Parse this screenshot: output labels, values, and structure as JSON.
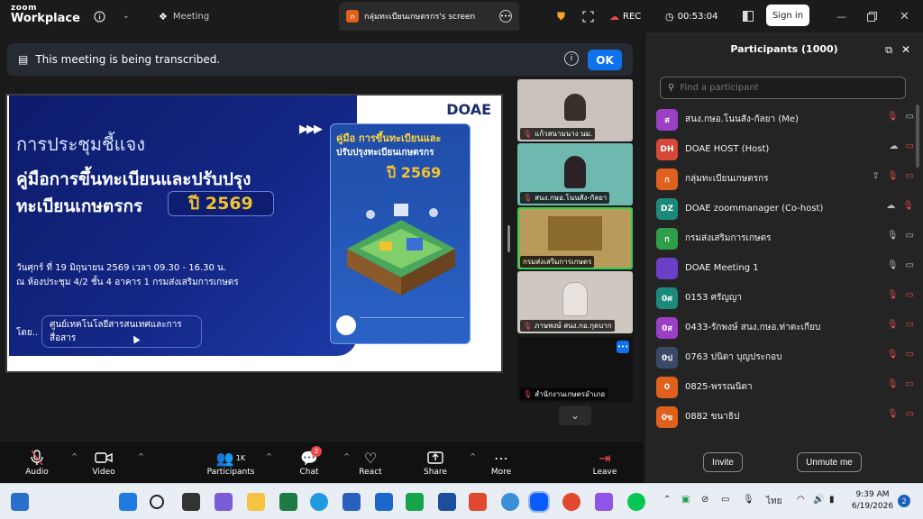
{
  "topbar": {
    "logo_line1": "zoom",
    "logo_line2": "Workplace",
    "meeting_label": "Meeting",
    "share_badge": "ก",
    "share_tab": "กลุ่มทะเบียนเกษตรกร's screen",
    "rec_label": "REC",
    "timer": "00:53:04",
    "signin_label": "Sign in"
  },
  "banner": {
    "text": "This meeting is being transcribed.",
    "ok_label": "OK"
  },
  "slide": {
    "logo": "DOAE",
    "title": "การประชุมชี้แจง",
    "heading1": "คู่มือการขึ้นทะเบียนและปรับปรุง",
    "heading2": "ทะเบียนเกษตรกร",
    "year": "ปี 2569",
    "detail1": "วันศุกร์ ที่ 19 มิถุนายน 2569 เวลา 09.30 - 16.30 น.",
    "detail2": "ณ ห้องประชุม 4/2 ชั้น 4 อาคาร 1 กรมส่งเสริมการเกษตร",
    "by_label": "โดย..",
    "organizer": "ศูนย์เทคโนโลยีสารสนเทศและการสื่อสาร",
    "book_title1": "คู่มือ การขึ้นทะเบียนและ",
    "book_title2": "ปรับปรุงทะเบียนเกษตรกร",
    "book_year": "ปี 2569"
  },
  "thumbnails": [
    {
      "name": "แก้วสนามนาง นม.",
      "bg": "#c9c2bd"
    },
    {
      "name": "สนง.กษอ.โนนสัง-กัลยา",
      "bg": "#6fb8b0"
    },
    {
      "name": "กรมส่งเสริมการเกษตร",
      "bg": "#b89a5a"
    },
    {
      "name": "ภาษพงษ์ สนง.กอ.กุดบาก",
      "bg": "#cfc8c0"
    },
    {
      "name": "สำนักงานเกษตรอำเภอ",
      "bg": "#111111"
    }
  ],
  "toolbar": {
    "audio": "Audio",
    "video": "Video",
    "participants": "Participants",
    "participants_count": "1K",
    "chat": "Chat",
    "chat_badge": "2",
    "react": "React",
    "share": "Share",
    "more": "More",
    "leave": "Leave"
  },
  "panel": {
    "title": "Participants (1000)",
    "search_placeholder": "Find a participant",
    "invite_label": "Invite",
    "unmute_label": "Unmute me",
    "participants": [
      {
        "initials": "ส",
        "color": "#9b3fc7",
        "name": "สนง.กษอ.โนนสัง-กัลยา (Me)",
        "icons": [
          "mic-off",
          "video"
        ]
      },
      {
        "initials": "DH",
        "color": "#d6483a",
        "name": "DOAE HOST (Host)",
        "icons": [
          "cloud",
          "video-off"
        ]
      },
      {
        "initials": "ก",
        "color": "#e0601e",
        "name": "กลุ่มทะเบียนเกษตรกร",
        "icons": [
          "share",
          "mic-off",
          "video-off"
        ]
      },
      {
        "initials": "DZ",
        "color": "#1c8a7a",
        "name": "DOAE zoommanager (Co-host)",
        "icons": [
          "cloud",
          "mic-off"
        ]
      },
      {
        "initials": "ก",
        "color": "#2e9e4a",
        "name": "กรมส่งเสริมการเกษตร",
        "icons": [
          "mic",
          "video"
        ]
      },
      {
        "initials": "",
        "color": "#6c3fc7",
        "name": "DOAE Meeting 1",
        "icons": [
          "mic",
          "video"
        ]
      },
      {
        "initials": "0ศ",
        "color": "#1c8a7a",
        "name": "0153 ศรัญญา",
        "icons": [
          "mic-off",
          "video-off"
        ]
      },
      {
        "initials": "0ส",
        "color": "#9b3fc7",
        "name": "0433-รักพงษ์ สนง.กษอ.ท่าตะเกียบ",
        "icons": [
          "mic-off",
          "video-off"
        ]
      },
      {
        "initials": "0ป",
        "color": "#3b4a66",
        "name": "0763 ปนิตา บุญประกอบ",
        "icons": [
          "mic-off",
          "video-off"
        ]
      },
      {
        "initials": "0",
        "color": "#e0601e",
        "name": "0825-พรรณนิดา",
        "icons": [
          "mic-off",
          "video-off"
        ]
      },
      {
        "initials": "0ข",
        "color": "#e0601e",
        "name": "0882 ขนาธิป",
        "icons": [
          "mic-off",
          "video-off"
        ]
      }
    ]
  },
  "taskbar": {
    "lang": "ไทย",
    "time": "9:39 AM",
    "date": "6/19/2026",
    "notif": "2"
  }
}
